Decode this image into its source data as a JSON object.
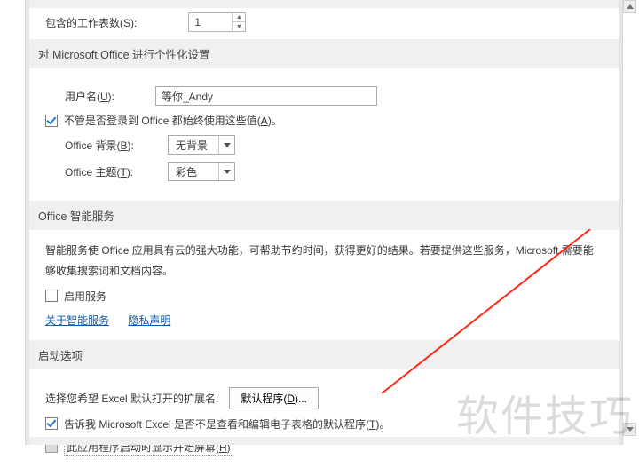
{
  "top": {
    "sheets_label_pre": "包含的工作表数(",
    "sheets_hotkey": "S",
    "sheets_label_post": "):",
    "sheets_value": "1"
  },
  "personalize": {
    "header": "对 Microsoft Office 进行个性化设置",
    "username_label_pre": "用户名(",
    "username_hotkey": "U",
    "username_label_post": "):",
    "username_value": "等你_Andy",
    "always_use_pre": "不管是否登录到 Office 都始终使用这些值(",
    "always_use_hotkey": "A",
    "always_use_post": ")。",
    "bg_label_pre": "Office 背景(",
    "bg_hotkey": "B",
    "bg_label_post": "):",
    "bg_value": "无背景",
    "theme_label_pre": "Office 主题(",
    "theme_hotkey": "T",
    "theme_label_post": "):",
    "theme_value": "彩色"
  },
  "intelligent": {
    "header": "Office 智能服务",
    "desc": "智能服务使 Office 应用具有云的强大功能，可帮助节约时间，获得更好的结果。若要提供这些服务，Microsoft 需要能够收集搜索词和文档内容。",
    "enable_label": "启用服务",
    "link_about": "关于智能服务",
    "link_privacy": "隐私声明"
  },
  "startup": {
    "header": "启动选项",
    "ext_label": "选择您希望 Excel 默认打开的扩展名:",
    "ext_btn_pre": "默认程序(",
    "ext_btn_hotkey": "D",
    "ext_btn_post": ")...",
    "tellme_pre": "告诉我 Microsoft Excel 是否不是查看和编辑电子表格的默认程序(",
    "tellme_hotkey": "T",
    "tellme_post": ")。",
    "startscreen_pre": "此应用程序启动时显示开始屏幕(",
    "startscreen_hotkey": "H",
    "startscreen_post": ")"
  },
  "watermark": "软件技巧"
}
